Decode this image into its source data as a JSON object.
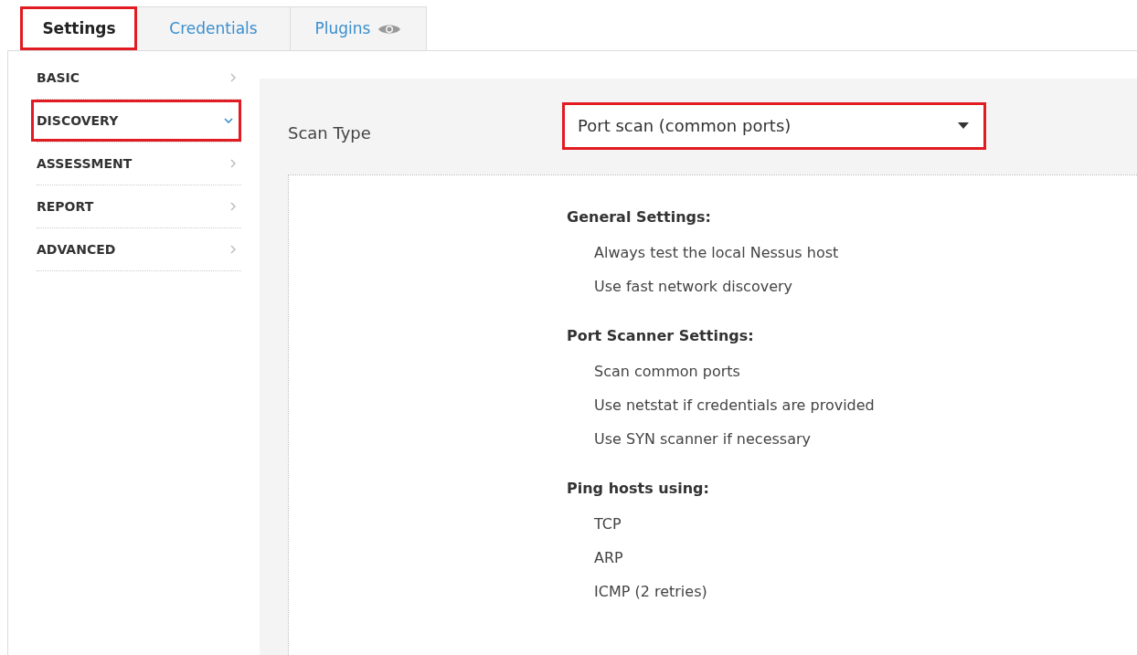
{
  "tabs": [
    {
      "label": "Settings",
      "selected": true,
      "highlighted": true,
      "icon": false
    },
    {
      "label": "Credentials",
      "selected": false,
      "highlighted": false,
      "icon": false
    },
    {
      "label": "Plugins",
      "selected": false,
      "highlighted": false,
      "icon": true
    }
  ],
  "sidebar": {
    "items": [
      {
        "label": "BASIC",
        "expanded": false,
        "highlighted": false
      },
      {
        "label": "DISCOVERY",
        "expanded": true,
        "highlighted": true
      },
      {
        "label": "ASSESSMENT",
        "expanded": false,
        "highlighted": false
      },
      {
        "label": "REPORT",
        "expanded": false,
        "highlighted": false
      },
      {
        "label": "ADVANCED",
        "expanded": false,
        "highlighted": false
      }
    ]
  },
  "scan_type": {
    "label": "Scan Type",
    "value": "Port scan (common ports)",
    "highlighted": true
  },
  "sections": [
    {
      "title": "General Settings:",
      "items": [
        "Always test the local Nessus host",
        "Use fast network discovery"
      ]
    },
    {
      "title": "Port Scanner Settings:",
      "items": [
        "Scan common ports",
        "Use netstat if credentials are provided",
        "Use SYN scanner if necessary"
      ]
    },
    {
      "title": "Ping hosts using:",
      "items": [
        "TCP",
        "ARP",
        "ICMP (2 retries)"
      ]
    }
  ]
}
